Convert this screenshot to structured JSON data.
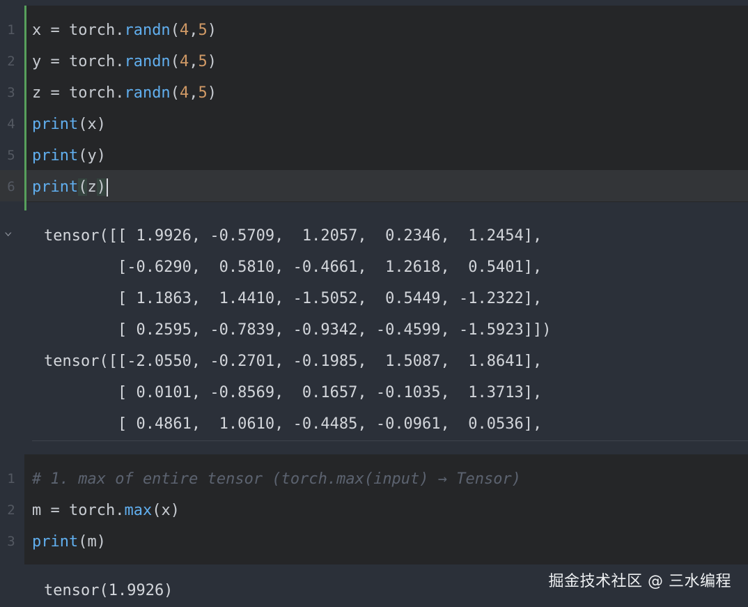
{
  "cell1": {
    "line_numbers": [
      "1",
      "2",
      "3",
      "4",
      "5",
      "6"
    ],
    "lines": [
      {
        "var": "x = torch.",
        "fn": "randn",
        "open": "(",
        "a": "4",
        "comma": ",",
        "b": "5",
        "close": ")"
      },
      {
        "var": "y = torch.",
        "fn": "randn",
        "open": "(",
        "a": "4",
        "comma": ",",
        "b": "5",
        "close": ")"
      },
      {
        "var": "z = torch.",
        "fn": "randn",
        "open": "(",
        "a": "4",
        "comma": ",",
        "b": "5",
        "close": ")"
      },
      {
        "kw": "print",
        "arg": "(x)"
      },
      {
        "kw": "print",
        "arg": "(y)"
      },
      {
        "kw": "print",
        "open": "(",
        "arg": "z",
        "close": ")"
      }
    ]
  },
  "output1": {
    "lines": [
      "tensor([[ 1.9926, -0.5709,  1.2057,  0.2346,  1.2454],",
      "        [-0.6290,  0.5810, -0.4661,  1.2618,  0.5401],",
      "        [ 1.1863,  1.4410, -1.5052,  0.5449, -1.2322],",
      "        [ 0.2595, -0.7839, -0.9342, -0.4599, -1.5923]])",
      "tensor([[-2.0550, -0.2701, -0.1985,  1.5087,  1.8641],",
      "        [ 0.0101, -0.8569,  0.1657, -0.1035,  1.3713],",
      "        [ 0.4861,  1.0610, -0.4485, -0.0961,  0.0536],"
    ]
  },
  "cell2": {
    "line_numbers": [
      "1",
      "2",
      "3"
    ],
    "comment": "# 1. max of entire tensor (torch.max(input) → Tensor)",
    "line2": {
      "pre": "m = torch.",
      "fn": "max",
      "post": "(x)"
    },
    "line3": {
      "kw": "print",
      "arg": "(m)"
    }
  },
  "output2": {
    "line": "tensor(1.9926)"
  },
  "watermark": "掘金技术社区 @ 三水编程",
  "icons": {
    "collapse": "chevron-down-icon"
  },
  "colors": {
    "background": "#2b3039",
    "cell_background": "#252628",
    "active_cell_border": "#57a05c",
    "function": "#61afef",
    "number": "#d19a66",
    "comment": "#5c6370"
  }
}
